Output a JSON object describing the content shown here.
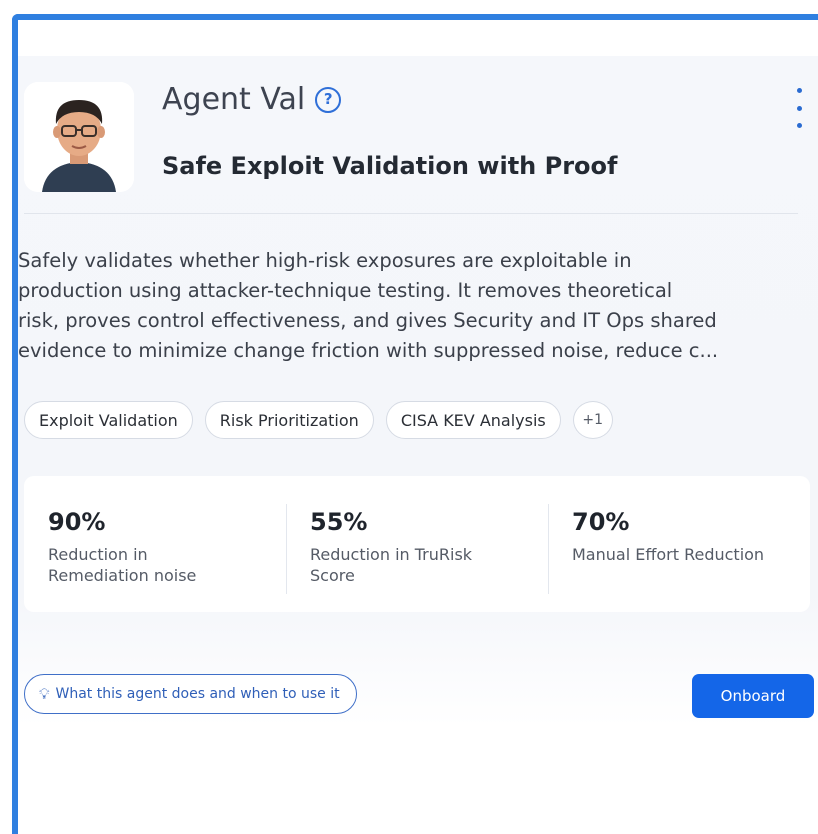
{
  "agent": {
    "name": "Agent Val",
    "tagline": "Safe Exploit Validation with Proof",
    "description_lines": [
      "Safely validates whether high-risk exposures are exploitable in",
      "production using attacker-technique testing. It removes theoretical",
      "risk, proves control effectiveness, and gives Security and IT Ops shared",
      "evidence to minimize change friction with suppressed noise, reduce c..."
    ]
  },
  "icons": {
    "help": "help-circle-icon",
    "menu": "vertical-ellipsis-icon",
    "hint": "lightbulb-icon",
    "avatar": "agent-avatar"
  },
  "tags": [
    {
      "label": "Exploit Validation"
    },
    {
      "label": "Risk Prioritization"
    },
    {
      "label": "CISA KEV Analysis"
    },
    {
      "label": "+1"
    }
  ],
  "stats": [
    {
      "value": "90%",
      "label": "Reduction in Remediation noise"
    },
    {
      "value": "55%",
      "label": "Reduction in TruRisk Score"
    },
    {
      "value": "70%",
      "label": "Manual Effort Reduction"
    }
  ],
  "footer": {
    "hint_label": "What this agent does and when to use it",
    "onboard_label": "Onboard"
  },
  "colors": {
    "accent": "#1466e8",
    "frame": "#2f7fe0"
  }
}
